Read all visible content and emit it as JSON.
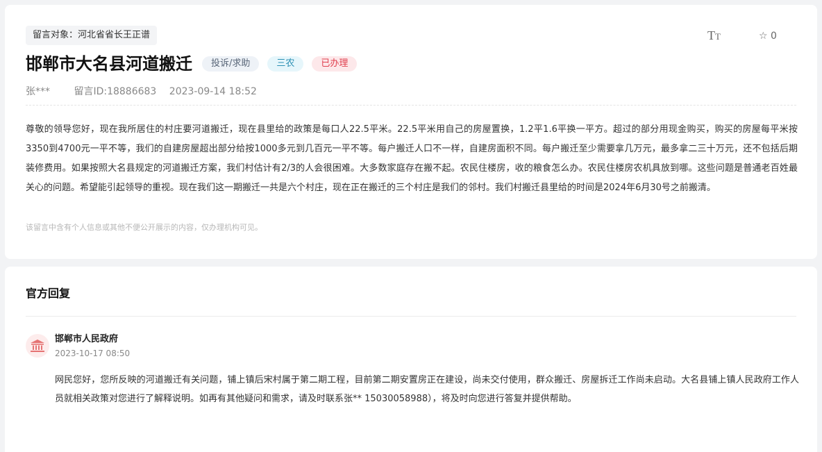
{
  "message": {
    "target": "留言对象：河北省省长王正谱",
    "font_tool_label_big": "T",
    "font_tool_label_small": "T",
    "favorite_icon": "☆",
    "favorite_count": "0",
    "title": "邯郸市大名县河道搬迁",
    "tags": {
      "type": "投诉/求助",
      "category": "三农",
      "status": "已办理"
    },
    "author": "张***",
    "message_id": "留言ID:18886683",
    "datetime": "2023-09-14 18:52",
    "content": "尊敬的领导您好，现在我所居住的村庄要河道搬迁，现在县里给的政策是每口人22.5平米。22.5平米用自己的房屋置换，1.2平1.6平换一平方。超过的部分用现金购买，购买的房屋每平米按3350到4700元一平不等，我们的自建房屋超出部分给按1000多元到几百元一平不等。每户搬迁人口不一样，自建房面积不同。每户搬迁至少需要拿几万元，最多拿二三十万元，还不包括后期装修费用。如果按照大名县规定的河道搬迁方案，我们村估计有2/3的人会很困难。大多数家庭存在搬不起。农民住楼房，收的粮食怎么办。农民住楼房农机具放到哪。这些问题是普通老百姓最关心的问题。希望能引起领导的重视。现在我们这一期搬迁一共是六个村庄，现在正在搬迁的三个村庄是我们的邻村。我们村搬迁县里给的时间是2024年6月30号之前搬清。",
    "privacy_notice": "该留言中含有个人信息或其他不便公开展示的内容，仅办理机构可见。"
  },
  "reply": {
    "section_title": "官方回复",
    "org_icon": "government-building-icon",
    "org_name": "邯郸市人民政府",
    "datetime": "2023-10-17 08:50",
    "content": "网民您好，您所反映的河道搬迁有关问题，铺上镇后宋村属于第二期工程，目前第二期安置房正在建设，尚未交付使用，群众搬迁、房屋拆迁工作尚未启动。大名县铺上镇人民政府工作人员就相关政策对您进行了解释说明。如再有其他疑问和需求，请及时联系张** 15030058988），将及时向您进行答复并提供帮助。"
  },
  "colors": {
    "status_red": "#e0404f",
    "category_blue": "#2a8fb3",
    "org_icon_red": "#e57373"
  }
}
